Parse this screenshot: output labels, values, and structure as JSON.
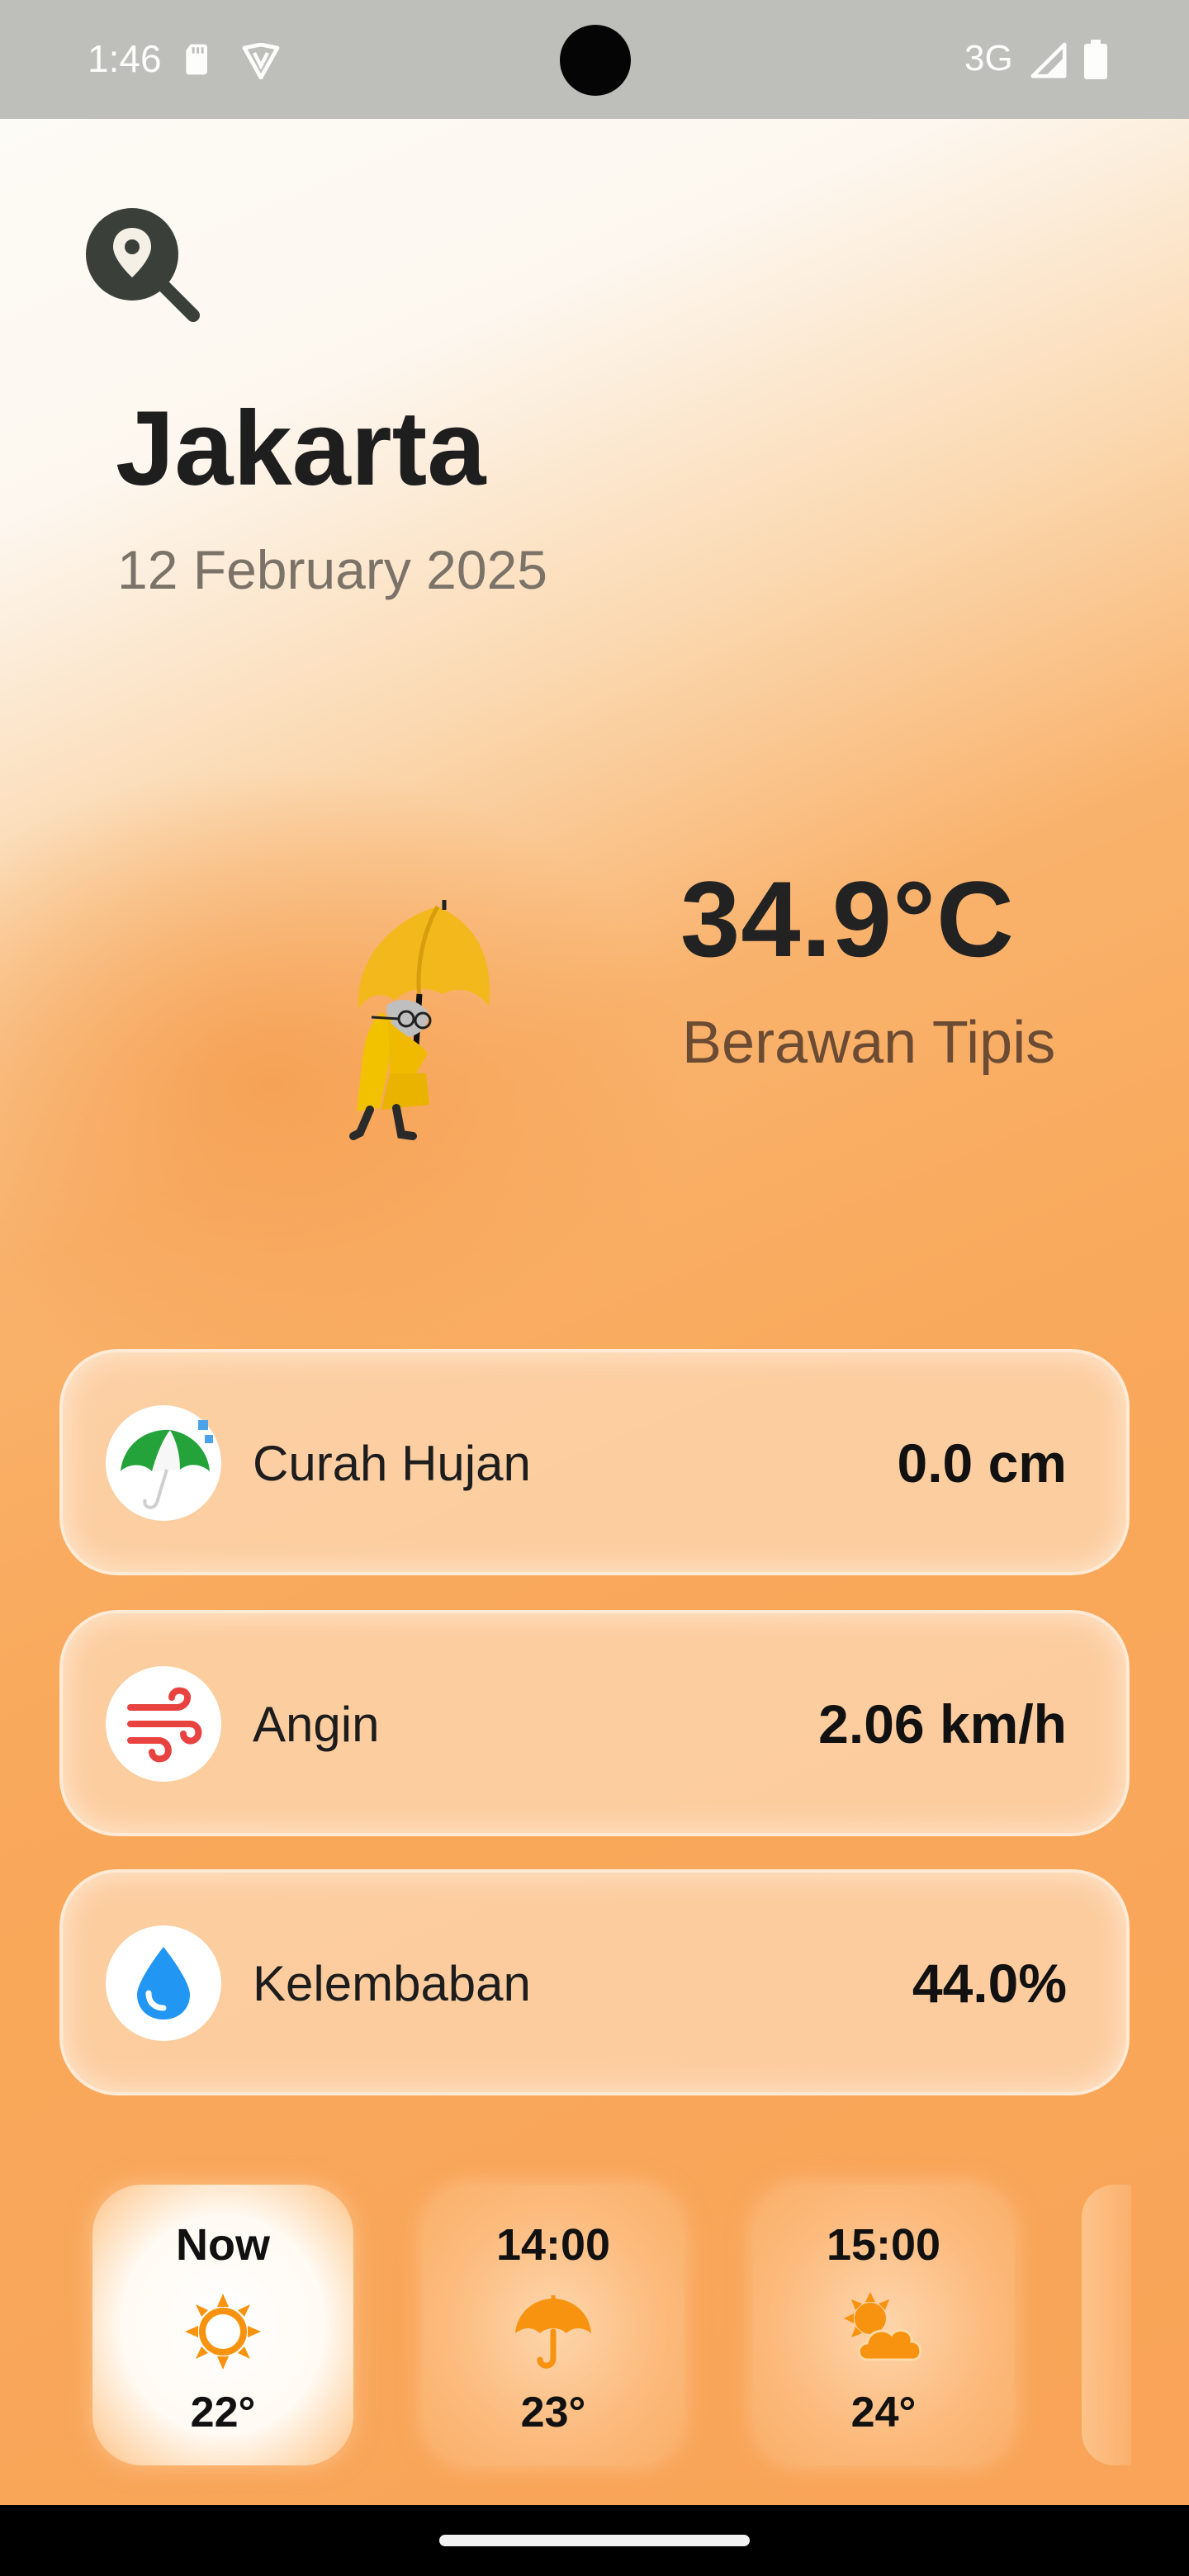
{
  "status_bar": {
    "time": "1:46",
    "network": "3G",
    "icons": [
      "sd-card-icon",
      "vpn-shield-icon",
      "signal-icon",
      "battery-icon"
    ]
  },
  "location": {
    "city": "Jakarta",
    "date": "12 February 2025"
  },
  "current": {
    "temperature": "34.9°C",
    "condition": "Berawan Tipis",
    "illustration": "person-with-umbrella-illustration"
  },
  "details": [
    {
      "label": "Curah Hujan",
      "value": "0.0 cm",
      "icon": "umbrella-icon"
    },
    {
      "label": "Angin",
      "value": "2.06 km/h",
      "icon": "wind-icon"
    },
    {
      "label": "Kelembaban",
      "value": "44.0%",
      "icon": "water-drop-icon"
    }
  ],
  "hourly": [
    {
      "time": "Now",
      "temp": "22°",
      "icon": "sun-icon",
      "selected": true
    },
    {
      "time": "14:00",
      "temp": "23°",
      "icon": "umbrella-rain-icon",
      "selected": false
    },
    {
      "time": "15:00",
      "temp": "24°",
      "icon": "sun-cloud-icon",
      "selected": false
    }
  ],
  "colors": {
    "accent_orange": "#f9a458",
    "icon_orange": "#f7930f",
    "search_icon": "#3a4039",
    "wind_red": "#e84341",
    "drop_blue": "#2196f3",
    "umbrella_green": "#23a33a"
  }
}
